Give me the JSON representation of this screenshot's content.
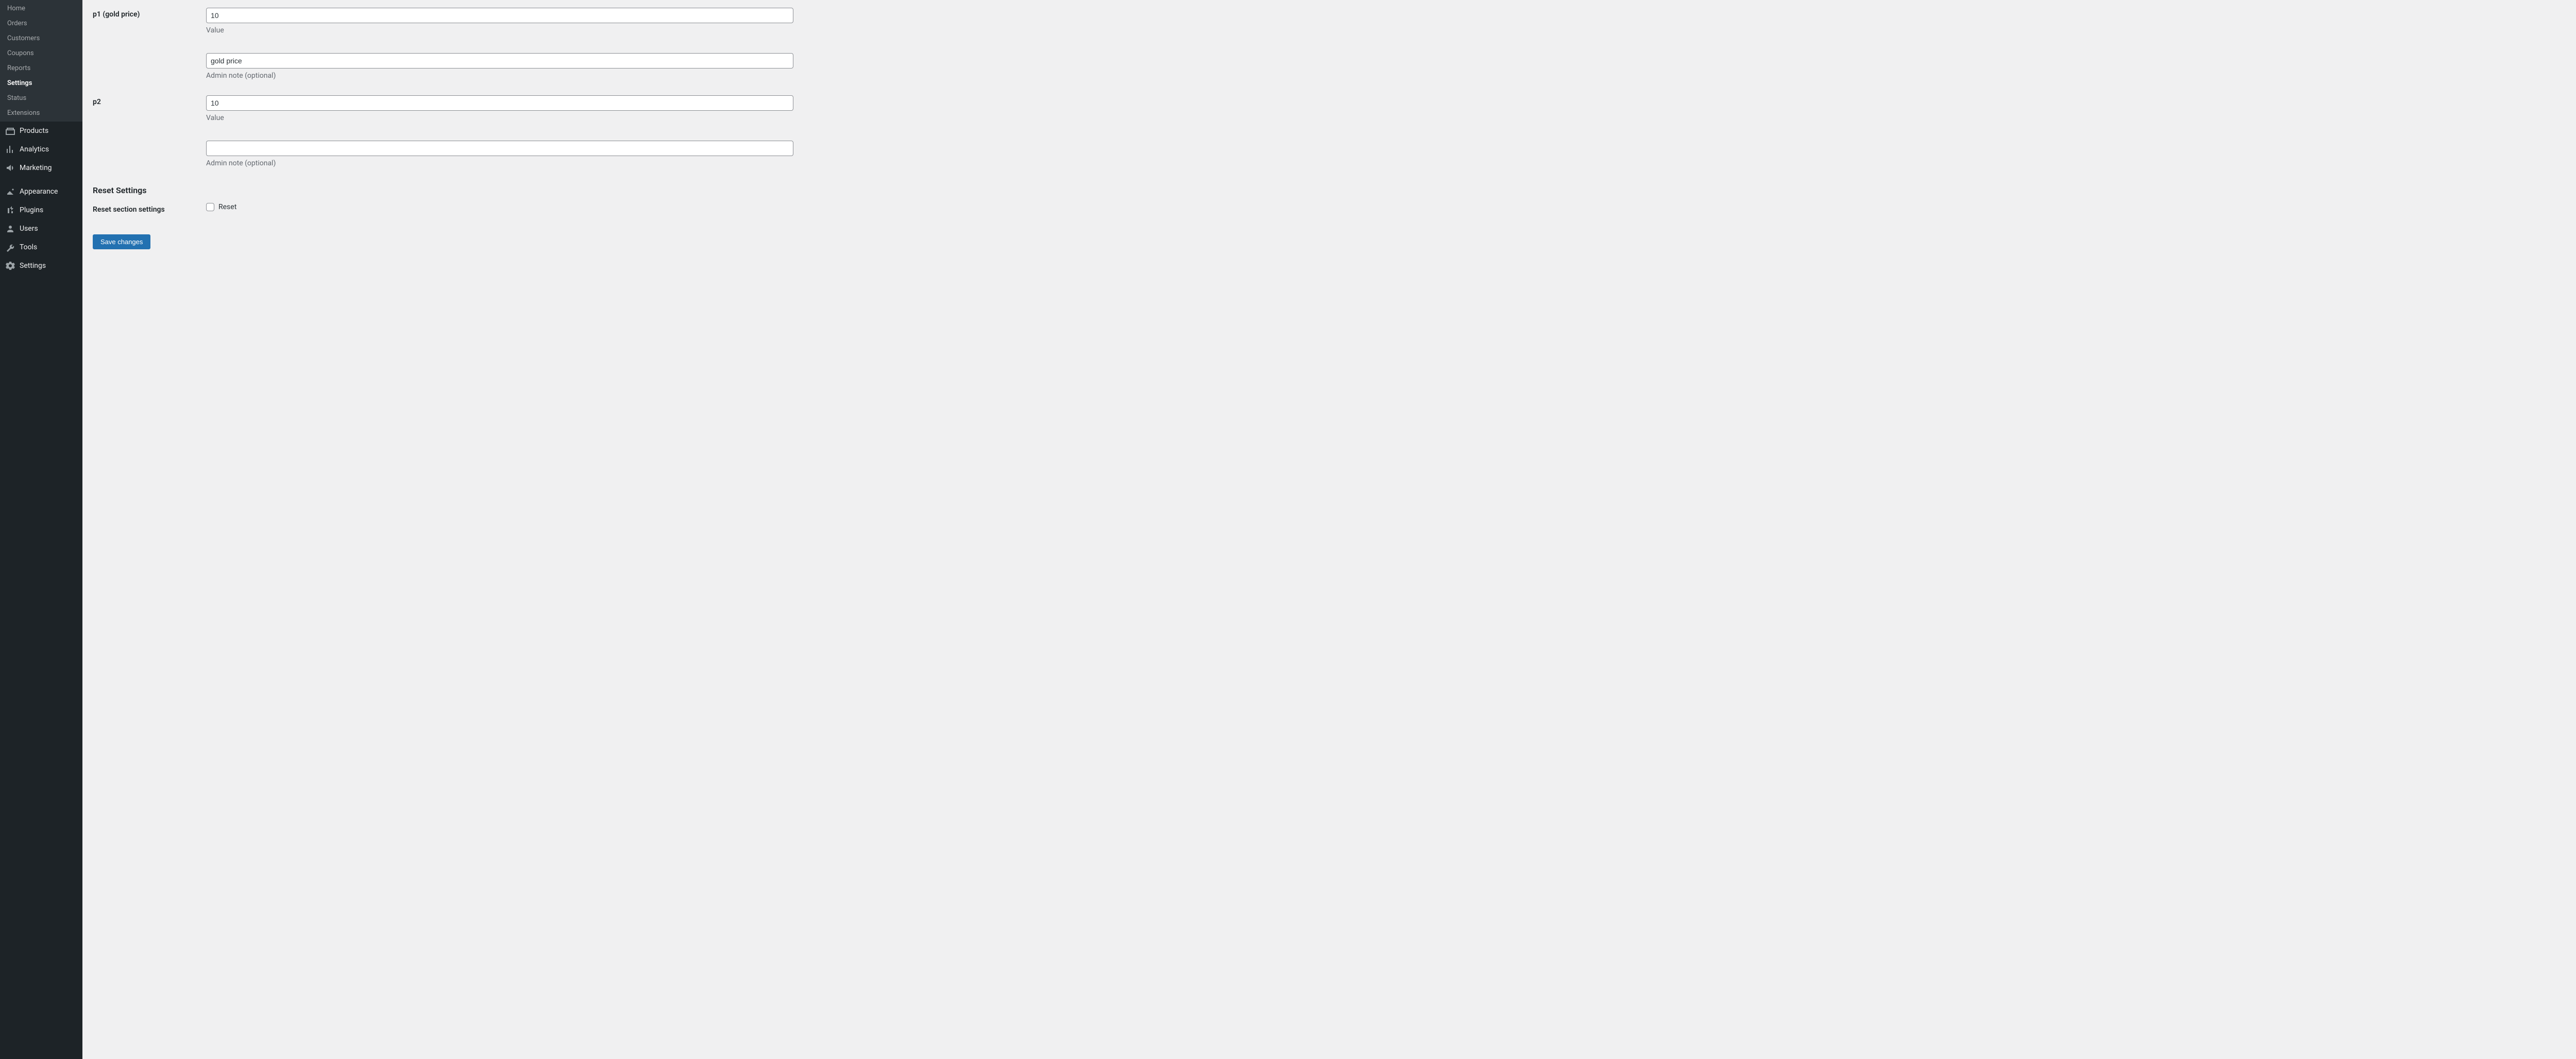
{
  "sidebar": {
    "sub": [
      {
        "label": "Home"
      },
      {
        "label": "Orders"
      },
      {
        "label": "Customers"
      },
      {
        "label": "Coupons"
      },
      {
        "label": "Reports"
      },
      {
        "label": "Settings"
      },
      {
        "label": "Status"
      },
      {
        "label": "Extensions"
      }
    ],
    "active_sub_index": 5,
    "top_a": [
      {
        "icon": "products",
        "label": "Products"
      },
      {
        "icon": "analytics",
        "label": "Analytics"
      },
      {
        "icon": "marketing",
        "label": "Marketing"
      }
    ],
    "top_b": [
      {
        "icon": "appearance",
        "label": "Appearance"
      },
      {
        "icon": "plugins",
        "label": "Plugins"
      },
      {
        "icon": "users",
        "label": "Users"
      },
      {
        "icon": "tools",
        "label": "Tools"
      },
      {
        "icon": "settings",
        "label": "Settings"
      }
    ]
  },
  "form": {
    "p1": {
      "label": "p1 (gold price)",
      "value": "10",
      "value_help": "Value",
      "note_value": "gold price",
      "note_help": "Admin note (optional)"
    },
    "p2": {
      "label": "p2",
      "value": "10",
      "value_help": "Value",
      "note_value": "",
      "note_help": "Admin note (optional)"
    },
    "reset": {
      "section_title": "Reset Settings",
      "row_label": "Reset section settings",
      "checkbox": false,
      "checkbox_label": "Reset"
    },
    "submit_label": "Save changes"
  }
}
